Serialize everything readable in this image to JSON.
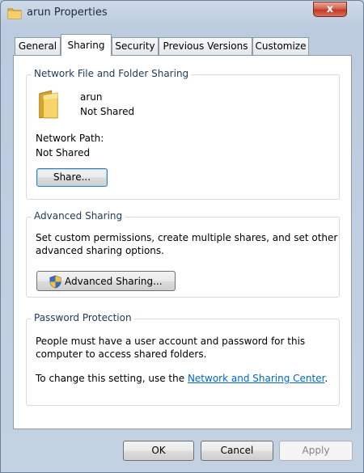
{
  "window": {
    "title": "arun Properties",
    "close_label": "x"
  },
  "tabs": [
    {
      "label": "General",
      "active": false
    },
    {
      "label": "Sharing",
      "active": true
    },
    {
      "label": "Security",
      "active": false
    },
    {
      "label": "Previous Versions",
      "active": false
    },
    {
      "label": "Customize",
      "active": false
    }
  ],
  "network_sharing": {
    "group_title": "Network File and Folder Sharing",
    "folder_name": "arun",
    "folder_status": "Not Shared",
    "path_label": "Network Path:",
    "path_value": "Not Shared",
    "share_button": "Share..."
  },
  "advanced_sharing": {
    "group_title": "Advanced Sharing",
    "description_line1": "Set custom permissions, create multiple shares, and set other",
    "description_line2": "advanced sharing options.",
    "button_label": "Advanced Sharing..."
  },
  "password_protection": {
    "group_title": "Password Protection",
    "description_line1": "People must have a user account and password for this",
    "description_line2": "computer to access shared folders.",
    "change_prefix": "To change this setting, use the ",
    "link_label": "Network and Sharing Center",
    "change_suffix": "."
  },
  "footer": {
    "ok_label": "OK",
    "cancel_label": "Cancel",
    "apply_label": "Apply"
  },
  "colors": {
    "folder": "#f2c94c",
    "link": "#0066cc",
    "group_title": "#1e395b"
  }
}
